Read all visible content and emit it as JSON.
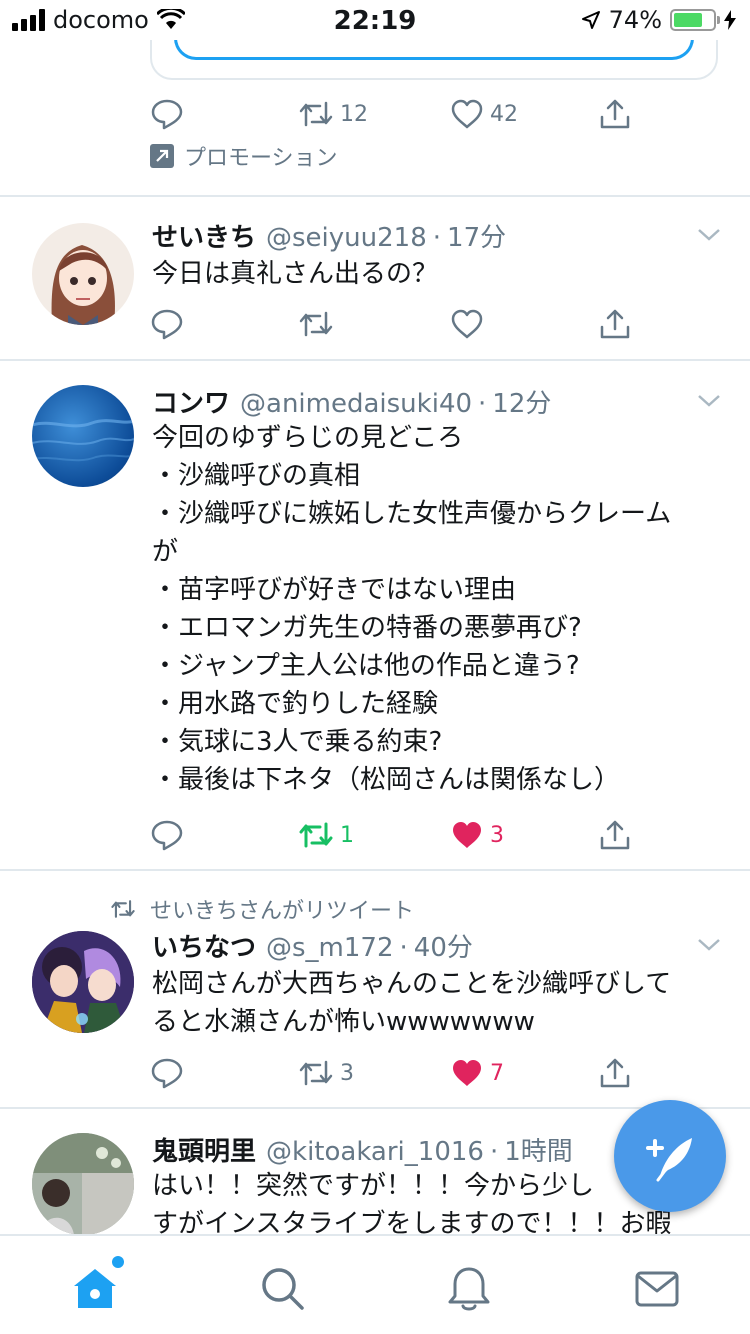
{
  "status_bar": {
    "carrier": "docomo",
    "time": "22:19",
    "battery_percent": "74%",
    "battery_level": 0.74
  },
  "promoted_tweet": {
    "retweet_count": "12",
    "like_count": "42",
    "promo_label": "プロモーション"
  },
  "tweets": [
    {
      "name": "せいきち",
      "handle": "@seiyuu218",
      "separator": "·",
      "ago": "17分",
      "lines": [
        "今日は真礼さん出るの？"
      ],
      "reply_count": "",
      "retweet_count": "",
      "like_count": ""
    },
    {
      "name": "コンワ",
      "handle": "@animedaisuki40",
      "separator": "·",
      "ago": "12分",
      "lines": [
        "今回のゆずらじの見どころ",
        "・沙織呼びの真相",
        "・沙織呼びに嫉妬した女性声優からクレーム",
        "が",
        "・苗字呼びが好きではない理由",
        "・エロマンガ先生の特番の悪夢再び?",
        "・ジャンプ主人公は他の作品と違う?",
        "・用水路で釣りした経験",
        "・気球に3人で乗る約束?",
        "・最後は下ネタ（松岡さんは関係なし）"
      ],
      "retweet_count": "1",
      "like_count": "3"
    },
    {
      "retweeted_by": "せいきちさんがリツイート",
      "name": "いちなつ",
      "handle": "@s_m172",
      "separator": "·",
      "ago": "40分",
      "lines": [
        "松岡さんが大西ちゃんのことを沙織呼びして",
        "ると水瀬さんが怖いwwwwwww"
      ],
      "retweet_count": "3",
      "like_count": "7"
    },
    {
      "name": "鬼頭明里",
      "handle": "@kitoakari_1016",
      "separator": "·",
      "ago": "1時間",
      "lines": [
        "はい！！突然ですが！！！今から少し",
        "すがインスタライブをしますので！！！お暇"
      ]
    }
  ],
  "colors": {
    "accent": "#1da1f2",
    "retweet_active": "#17bf63",
    "like_active": "#e0245e",
    "muted": "#657786"
  },
  "icons": [
    "reply-icon",
    "retweet-icon",
    "like-icon",
    "share-icon",
    "home-icon",
    "search-icon",
    "notifications-icon",
    "messages-icon",
    "compose-icon"
  ]
}
